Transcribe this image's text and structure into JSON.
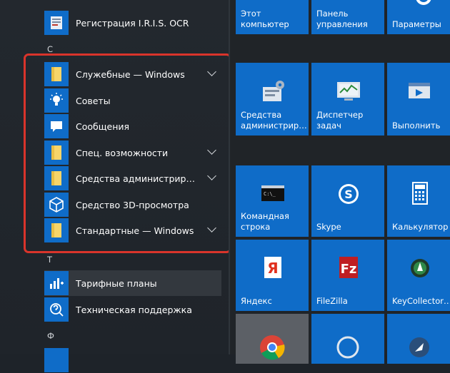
{
  "app_list": {
    "top_item": {
      "label": "Регистрация I.R.I.S. OCR",
      "icon": "ocr-registration-icon"
    },
    "letter_c": "С",
    "letter_t": "Т",
    "letter_f": "Ф",
    "items_c": [
      {
        "label": "Служебные — Windows",
        "icon": "folder-icon",
        "expandable": true
      },
      {
        "label": "Советы",
        "icon": "lightbulb-icon",
        "expandable": false
      },
      {
        "label": "Сообщения",
        "icon": "message-icon",
        "expandable": false
      },
      {
        "label": "Спец. возможности",
        "icon": "folder-icon",
        "expandable": true
      },
      {
        "label": "Средства администрирования…",
        "icon": "folder-icon",
        "expandable": true
      },
      {
        "label": "Средство 3D-просмотра",
        "icon": "3d-cube-icon",
        "expandable": false
      },
      {
        "label": "Стандартные — Windows",
        "icon": "folder-icon",
        "expandable": true
      }
    ],
    "items_t": [
      {
        "label": "Тарифные планы",
        "icon": "tariff-plans-icon"
      },
      {
        "label": "Техническая поддержка",
        "icon": "support-icon"
      }
    ]
  },
  "tiles": {
    "row0": [
      {
        "label": "Этот\nкомпьютер",
        "icon": "computer-icon"
      },
      {
        "label": "Панель\nуправления",
        "icon": "control-panel-icon"
      },
      {
        "label": "Параметры",
        "icon": "gear-icon"
      }
    ],
    "row1": [
      {
        "label": "Средства\nадминистрир…",
        "icon": "admin-tools-icon"
      },
      {
        "label": "Диспетчер\nзадач",
        "icon": "task-manager-icon"
      },
      {
        "label": "Выполнить",
        "icon": "run-icon"
      }
    ],
    "row2": [
      {
        "label": "Командная\nстрока",
        "icon": "command-prompt-icon"
      },
      {
        "label": "Skype",
        "icon": "skype-icon"
      },
      {
        "label": "Калькулятор",
        "icon": "calculator-icon"
      }
    ],
    "row3": [
      {
        "label": "Яндекс",
        "icon": "yandex-icon"
      },
      {
        "label": "FileZilla",
        "icon": "filezilla-icon"
      },
      {
        "label": "KeyCollector…",
        "icon": "keycollector-icon"
      }
    ]
  },
  "colors": {
    "tile_blue": "#0f6cc8",
    "highlight_red": "#d9342b",
    "background": "#1e2329"
  }
}
